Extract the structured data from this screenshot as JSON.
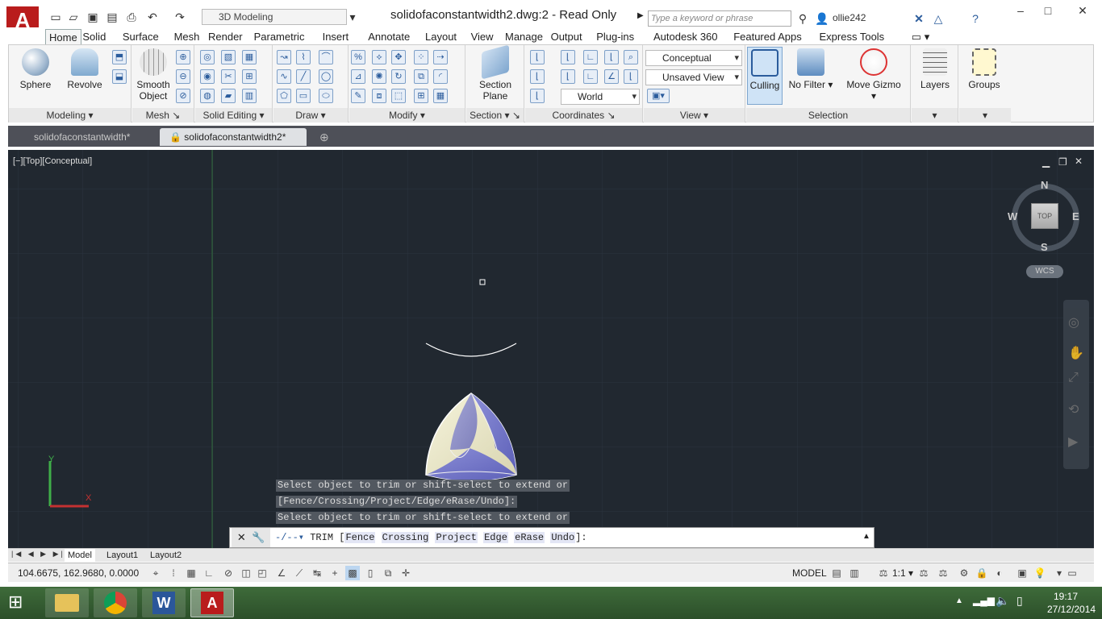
{
  "app": {
    "title": "solidofaconstantwidth2.dwg:2 - Read Only",
    "logo": "A",
    "workspace": "3D Modeling",
    "search_placeholder": "Type a keyword or phrase",
    "user": "ollie242"
  },
  "ribbon_tabs": [
    "Home",
    "Solid",
    "Surface",
    "Mesh",
    "Render",
    "Parametric",
    "Insert",
    "Annotate",
    "Layout",
    "View",
    "Manage",
    "Output",
    "Plug-ins",
    "Autodesk 360",
    "Featured Apps",
    "Express Tools"
  ],
  "active_tab": "Home",
  "ribbon": {
    "modeling": {
      "title": "Modeling",
      "sphere": "Sphere",
      "revolve": "Revolve"
    },
    "mesh": {
      "title": "Mesh",
      "smooth": "Smooth",
      "object": "Object"
    },
    "solid_editing": {
      "title": "Solid Editing"
    },
    "draw": {
      "title": "Draw"
    },
    "modify": {
      "title": "Modify"
    },
    "section": {
      "title": "Section",
      "plane1": "Section",
      "plane2": "Plane"
    },
    "coordinates": {
      "title": "Coordinates",
      "world": "World"
    },
    "view": {
      "title": "View",
      "visual_style": "Conceptual",
      "saved_view": "Unsaved View"
    },
    "selection": {
      "title": "Selection",
      "culling": "Culling",
      "no_filter": "No Filter",
      "move_gizmo": "Move Gizmo"
    },
    "layers": {
      "label": "Layers"
    },
    "groups": {
      "label": "Groups"
    }
  },
  "doc_tabs": [
    "solidofaconstantwidth*",
    "solidofaconstantwidth2*"
  ],
  "viewport": {
    "label": "[−][Top][Conceptual]",
    "viewcube": {
      "n": "N",
      "s": "S",
      "e": "E",
      "w": "W",
      "face": "TOP",
      "wcs": "WCS"
    },
    "ucs": {
      "y": "Y",
      "x": "X"
    }
  },
  "command_history": [
    "Select object to trim or shift-select to extend or",
    "[Fence/Crossing/Project/Edge/eRase/Undo]:",
    "Select object to trim or shift-select to extend or"
  ],
  "command": {
    "name": "TRIM",
    "open": "[",
    "options": [
      "Fence",
      "Crossing",
      "Project",
      "Edge",
      "eRase",
      "Undo"
    ],
    "close": "]:"
  },
  "layout_tabs": [
    "Model",
    "Layout1",
    "Layout2"
  ],
  "status": {
    "coords": "104.6675, 162.9680, 0.0000",
    "model": "MODEL",
    "scale": "1:1"
  },
  "taskbar": {
    "time": "19:17",
    "date": "27/12/2014"
  },
  "colors": {
    "viewport_bg": "#212830",
    "accent_blue": "#2b5c9c",
    "autocad_red": "#b91c1c"
  }
}
